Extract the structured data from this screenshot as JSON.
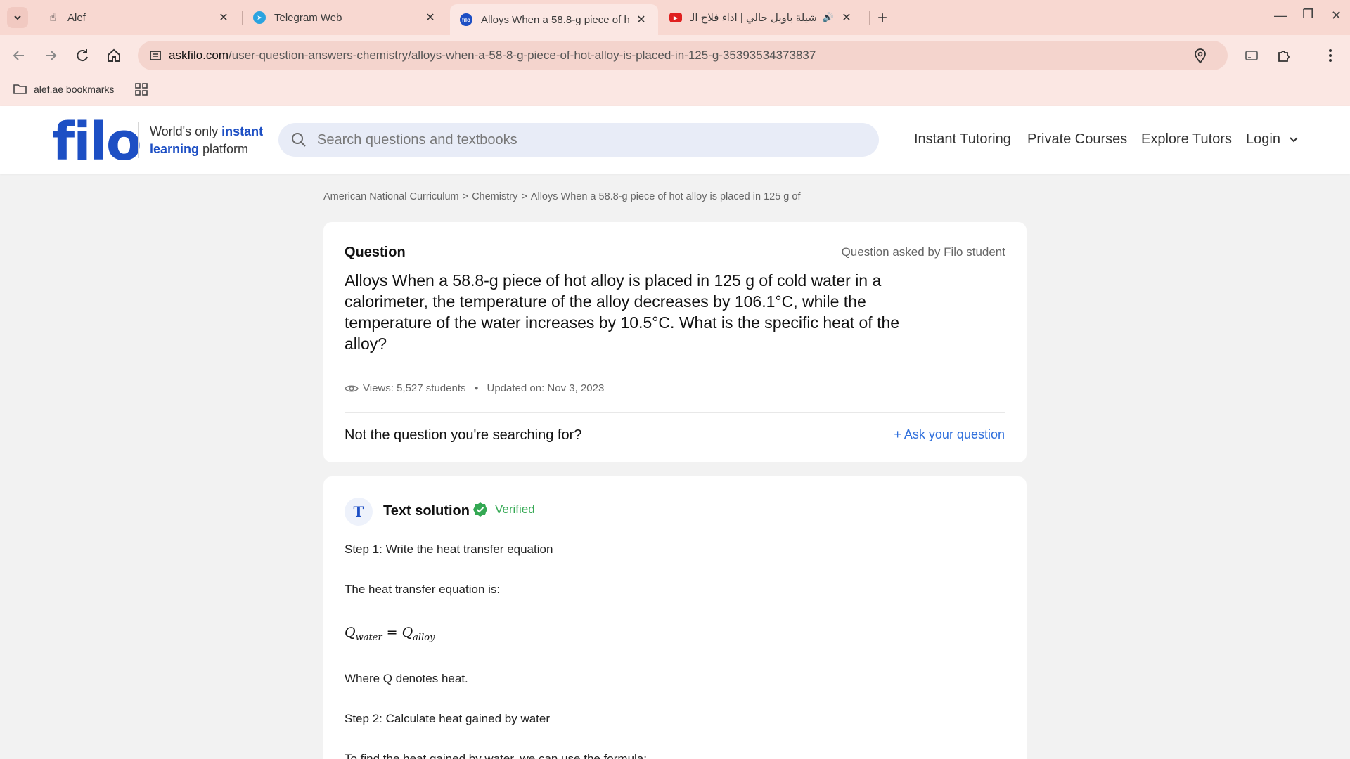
{
  "browser": {
    "tabs": [
      {
        "title": "Alef",
        "active": false,
        "icon": "hand-icon"
      },
      {
        "title": "Telegram Web",
        "active": false,
        "icon": "telegram-icon"
      },
      {
        "title": "Alloys When a 58.8-g piece of h",
        "active": true,
        "icon": "filo-icon"
      },
      {
        "title": "شيلة باويل حالي | اداء فلاح المـ",
        "active": false,
        "icon": "youtube-icon"
      }
    ],
    "url_host": "askfilo.com",
    "url_path": "/user-question-answers-chemistry/alloys-when-a-58-8-g-piece-of-hot-alloy-is-placed-in-125-g-35393534373837",
    "bookmarks": {
      "folder_label": "alef.ae bookmarks"
    }
  },
  "site": {
    "logo": "filo",
    "tagline_part1": "World's only ",
    "tagline_bold1": "instant",
    "tagline_bold2": "learning",
    "tagline_part2": " platform",
    "search_placeholder": "Search questions and textbooks",
    "nav": [
      "Instant Tutoring",
      "Private Courses",
      "Explore Tutors",
      "Login"
    ]
  },
  "breadcrumb": [
    "American National Curriculum",
    "Chemistry",
    "Alloys When a 58.8-g piece of hot alloy is placed in 125 g of"
  ],
  "question": {
    "heading": "Question",
    "asked_by": "Question asked by Filo student",
    "text": "Alloys When a 58.8-g piece of hot alloy is placed in 125 g of cold water in a calorimeter, the temperature of the alloy decreases by 106.1°C, while the temperature of the water increases by 10.5°C. What is the specific heat of the alloy?",
    "views": "Views: 5,527 students",
    "updated": "Updated on: Nov 3, 2023",
    "not_searching": "Not the question you're searching for?",
    "ask_label": "+ Ask your question"
  },
  "solution": {
    "icon_letter": "T",
    "title": "Text solution",
    "verified": "Verified",
    "step1": "Step 1: Write the heat transfer equation",
    "line1": "The heat transfer equation is:",
    "formula_lhs": "Q",
    "formula_lhs_sub": "water",
    "formula_eq": " = ",
    "formula_rhs": "Q",
    "formula_rhs_sub": "alloy",
    "line2": "Where Q denotes heat.",
    "step2": "Step 2: Calculate heat gained by water",
    "line3": "To find the heat gained by water, we can use the formula:"
  },
  "colors": {
    "brand": "#1d4fc4",
    "link": "#2f6fdc",
    "verified": "#34a853"
  }
}
